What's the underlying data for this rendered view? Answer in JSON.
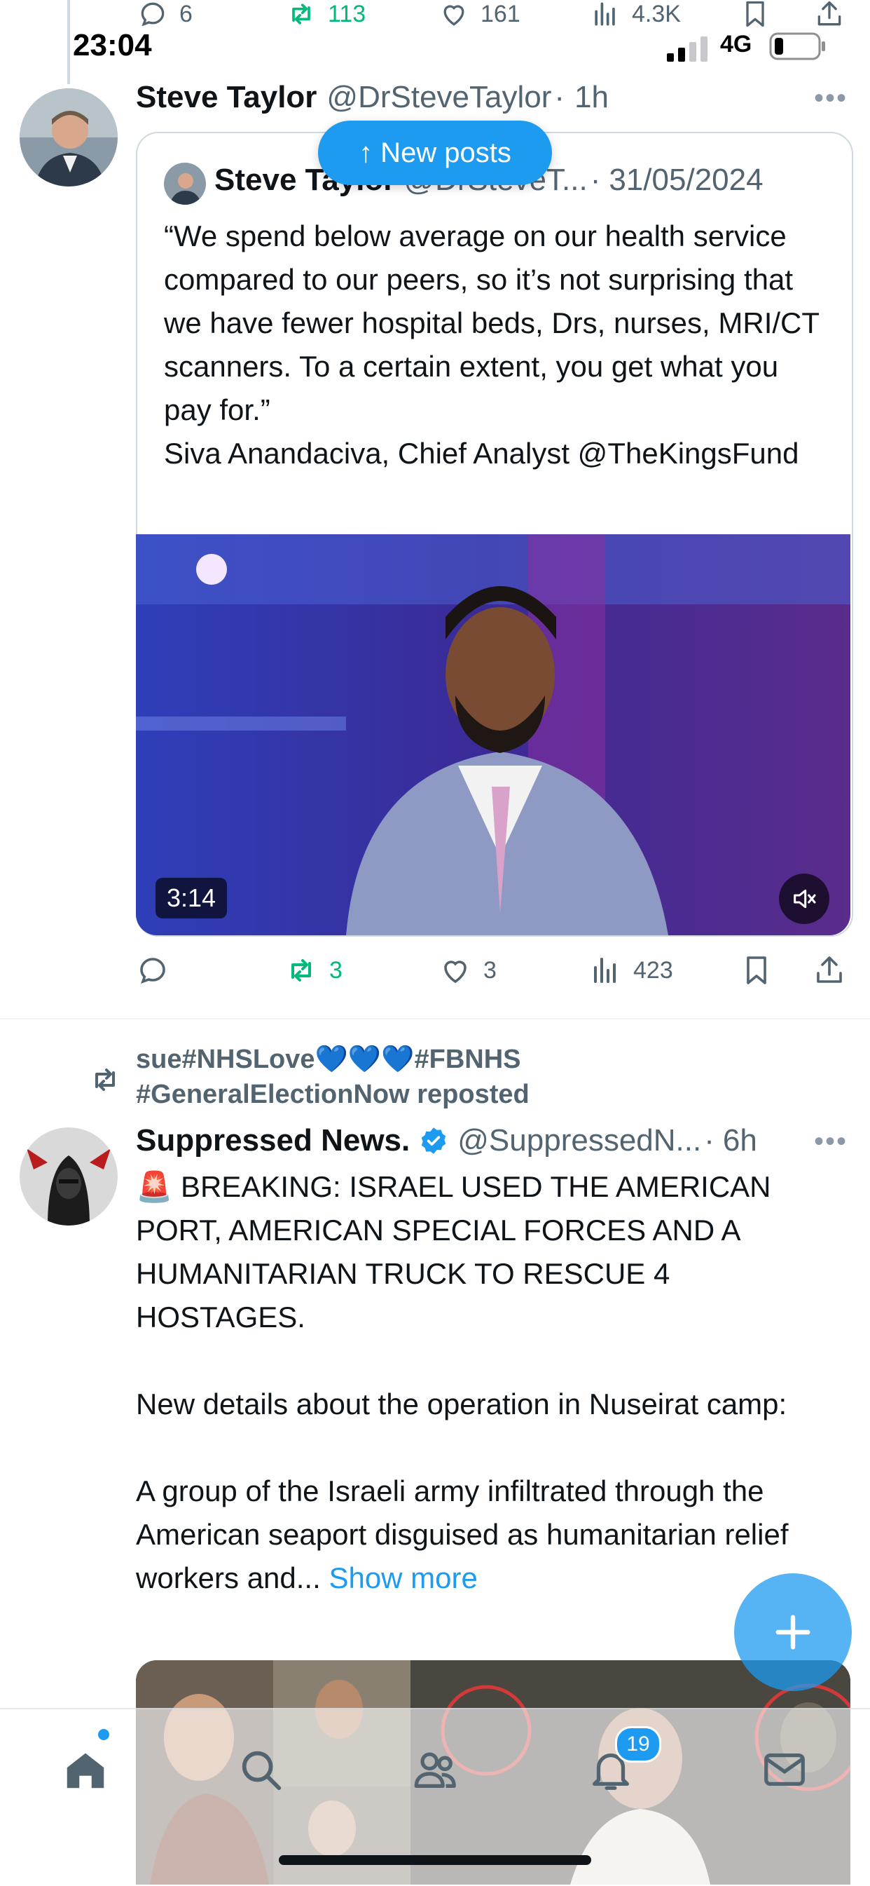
{
  "top_actions": {
    "replies": "6",
    "reposts": "113",
    "likes": "161",
    "views": "4.3K"
  },
  "status_bar": {
    "time": "23:04",
    "network": "4G",
    "battery_level": 0.2
  },
  "new_posts_button": "↑ New posts",
  "post1": {
    "author_name": "Steve Taylor",
    "author_handle": "@DrSteveTaylor",
    "separator": "·",
    "time": "1h",
    "quote": {
      "author_name": "Steve Taylor",
      "author_handle": "@DrSteveT...",
      "separator": "·",
      "date": "31/05/2024",
      "text": "“We spend below average on our health service compared to our peers, so it’s not surprising that we have fewer hospital beds, Drs, nurses, MRI/CT scanners. To a certain extent, you get what you pay for.”\nSiva Anandaciva, Chief Analyst @TheKingsFund",
      "video_duration": "3:14"
    },
    "stats": {
      "replies": "",
      "reposts": "3",
      "likes": "3",
      "views": "423"
    }
  },
  "post2": {
    "repost_line1": "sue#NHSLove💙💙💙#FBNHS",
    "repost_line2": "#GeneralElectionNow reposted",
    "author_name": "Suppressed News.",
    "author_handle": "@SuppressedN...",
    "separator": "·",
    "time": "6h",
    "text": "🚨 BREAKING: ISRAEL USED THE AMERICAN PORT, AMERICAN SPECIAL FORCES AND A HUMANITARIAN TRUCK TO RESCUE 4 HOSTAGES.\n\nNew details about the operation in Nuseirat camp:\n\nA group of the Israeli army infiltrated through the American seaport disguised as humanitarian relief workers and... ",
    "show_more": "Show more"
  },
  "tab_bar": {
    "notifications_badge": "19"
  },
  "colors": {
    "accent": "#1d9bf0",
    "repost_green": "#00ba7c",
    "secondary_text": "#536471"
  }
}
